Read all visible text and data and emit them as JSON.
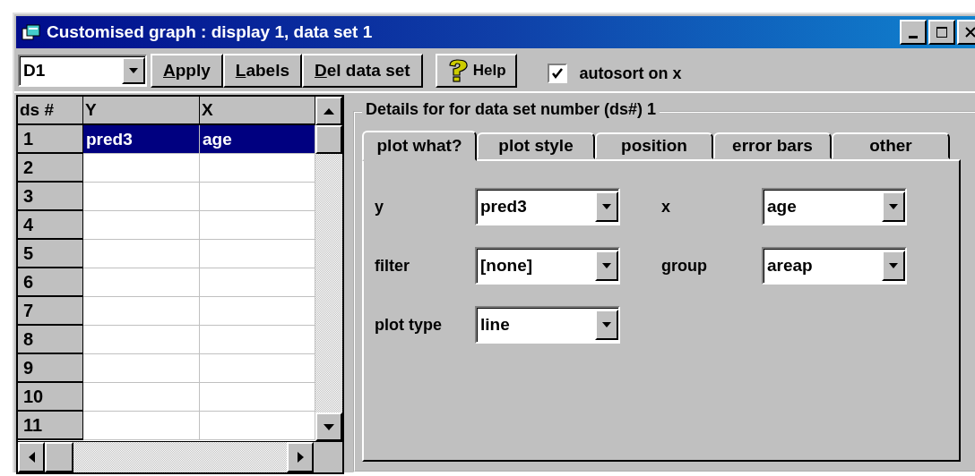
{
  "window": {
    "title": "Customised graph : display  1, data set 1"
  },
  "toolbar": {
    "display_select": "D1",
    "buttons": [
      {
        "label": "Apply",
        "mnemonic": true,
        "kind": "text"
      },
      {
        "label": "Labels",
        "mnemonic": true,
        "kind": "text"
      },
      {
        "label": "Del data set",
        "mnemonic": true,
        "kind": "text"
      },
      {
        "label": "Help",
        "kind": "help"
      }
    ],
    "autosort": {
      "label": "autosort on x",
      "checked": true
    }
  },
  "grid": {
    "columns": [
      "ds #",
      "Y",
      "X"
    ],
    "rows": [
      {
        "number": "1",
        "y": "pred3",
        "x": "age",
        "selected": true
      },
      {
        "number": "2",
        "selected": false
      },
      {
        "number": "3",
        "selected": false
      },
      {
        "number": "4",
        "selected": false
      },
      {
        "number": "5",
        "selected": false
      },
      {
        "number": "6",
        "selected": false
      },
      {
        "number": "7",
        "selected": false
      },
      {
        "number": "8",
        "selected": false
      },
      {
        "number": "9",
        "selected": false
      },
      {
        "number": "10",
        "selected": false
      },
      {
        "number": "11",
        "selected": false
      }
    ]
  },
  "details": {
    "title": "Details for for data set number (ds#) 1",
    "tabs": [
      {
        "label": "plot what?",
        "selected": true
      },
      {
        "label": "plot style",
        "selected": false
      },
      {
        "label": "position",
        "selected": false
      },
      {
        "label": "error bars",
        "selected": false
      },
      {
        "label": "other",
        "selected": false
      }
    ],
    "fields": [
      {
        "label": "y",
        "value": "pred3"
      },
      {
        "label": "x",
        "value": "age"
      },
      {
        "label": "filter",
        "value": "[none]"
      },
      {
        "label": "group",
        "value": "areap"
      },
      {
        "label": "plot type",
        "value": "line"
      }
    ]
  }
}
